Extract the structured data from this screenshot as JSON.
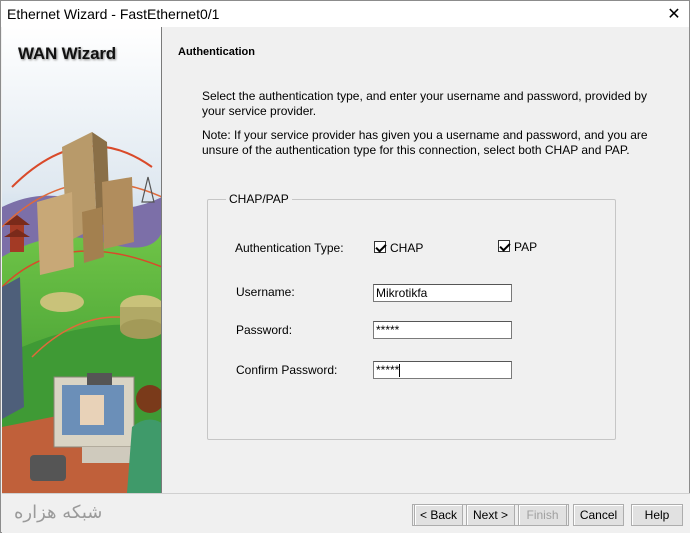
{
  "window": {
    "title": "Ethernet Wizard - FastEthernet0/1",
    "close_glyph": "✕"
  },
  "sidebar": {
    "title": "WAN Wizard"
  },
  "page": {
    "section_title": "Authentication",
    "instruction": "Select the authentication type, and enter your username and password, provided by your service provider.",
    "note": "Note: If your service provider has given you a username and password, and you are unsure of the authentication type for this connection, select both CHAP and PAP."
  },
  "group": {
    "legend": "CHAP/PAP",
    "auth_type_label": "Authentication Type:",
    "chap_label": "CHAP",
    "chap_checked": true,
    "pap_label": "PAP",
    "pap_checked": true,
    "username_label": "Username:",
    "username_value": "Mikrotikfa",
    "password_label": "Password:",
    "password_value": "*****",
    "confirm_label": "Confirm Password:",
    "confirm_value": "*****"
  },
  "footer": {
    "watermark": "شبکه هزاره",
    "back_label": "< Back",
    "next_label": "Next >",
    "finish_label": "Finish",
    "cancel_label": "Cancel",
    "help_label": "Help"
  }
}
